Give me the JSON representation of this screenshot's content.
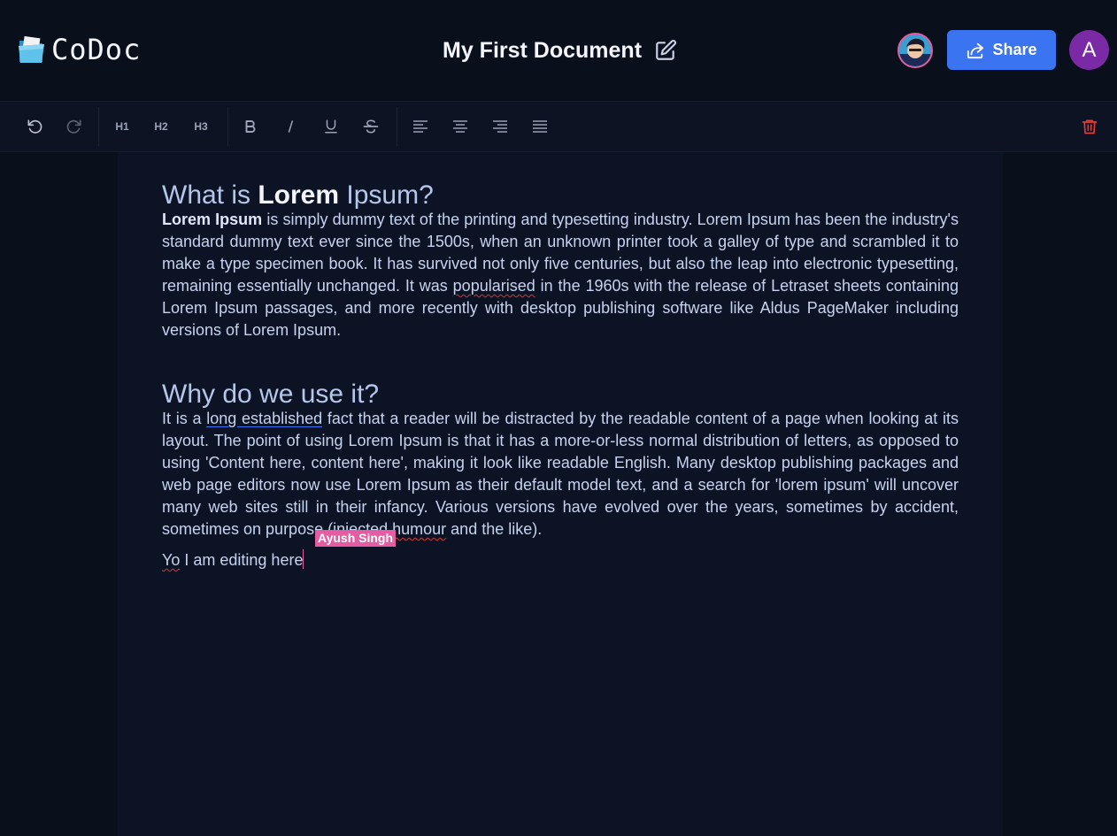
{
  "app": {
    "name": "CoDoc"
  },
  "document": {
    "title": "My First Document"
  },
  "header": {
    "share_label": "Share",
    "user_initial": "A"
  },
  "toolbar": {
    "h1": "H1",
    "h2": "H2",
    "h3": "H3"
  },
  "content": {
    "s1": {
      "heading_pre": "What is ",
      "heading_bold": "Lorem",
      "heading_post": " Ipsum?",
      "lead_bold": "Lorem Ipsum",
      "text_a": " is simply dummy text of the printing and typesetting industry. Lorem Ipsum has been the industry's standard dummy text ever since the 1500s, when an unknown printer took a galley of type and scrambled it to make a type specimen book. It has survived not only five centuries, but also the leap into electronic typesetting, remaining essentially unchanged. It was ",
      "misspelled": "popularised",
      "text_b": " in the 1960s with the release of Letraset sheets containing Lorem Ipsum passages, and more recently with desktop publishing software like Aldus PageMaker including versions of Lorem Ipsum."
    },
    "s2": {
      "heading": "Why do we use it?",
      "text_a": "It is a ",
      "underlined": "long established",
      "text_b": " fact that a reader will be distracted by the readable content of a page when looking at its layout. The point of using Lorem Ipsum is that it has a more-or-less normal distribution of letters, as opposed to using 'Content here, content here', making it look like readable English. Many desktop publishing packages and web page editors now use Lorem Ipsum as their default model text, and a search for 'lorem ipsum' will uncover many web sites still in their infancy. Various versions have evolved over the years, sometimes by accident, sometimes on purpose (injected ",
      "misspelled": "humour",
      "text_c": " and the like)."
    },
    "edit": {
      "misspelled": "Yo",
      "rest": " I am editing here"
    },
    "collaborator": {
      "name": "Ayush Singh",
      "color": "#e45da3"
    }
  },
  "colors": {
    "accent": "#3b74f0",
    "delete": "#e03b3b",
    "avatar": "#7b2aa6"
  },
  "icons": [
    "folder-icon",
    "edit-icon",
    "share-icon",
    "undo-icon",
    "redo-icon",
    "bold-icon",
    "italic-icon",
    "underline-icon",
    "strikethrough-icon",
    "align-left-icon",
    "align-center-icon",
    "align-right-icon",
    "align-justify-icon",
    "trash-icon"
  ]
}
